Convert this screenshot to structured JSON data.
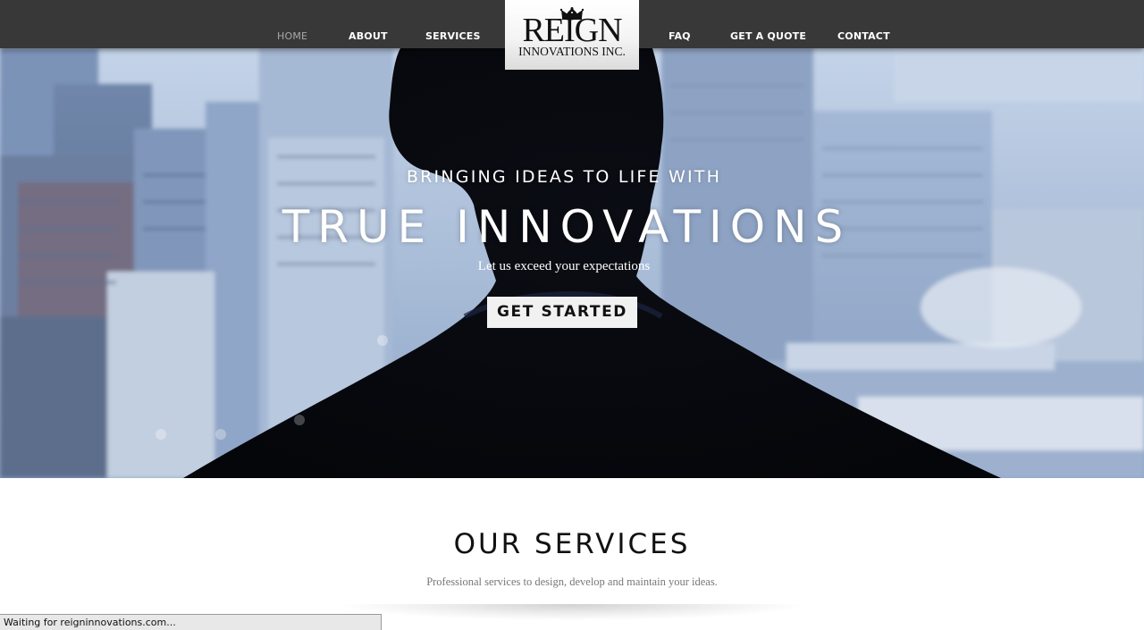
{
  "nav": {
    "items": [
      {
        "label": "HOME",
        "active": true
      },
      {
        "label": "ABOUT"
      },
      {
        "label": "SERVICES"
      },
      {
        "label": "FAQ"
      },
      {
        "label": "GET A QUOTE"
      },
      {
        "label": "CONTACT"
      }
    ]
  },
  "logo": {
    "main": "REIGN",
    "sub": "INNOVATIONS INC.",
    "icon": "crown-icon"
  },
  "hero": {
    "kicker": "BRINGING IDEAS TO LIFE WITH",
    "title": "TRUE INNOVATIONS",
    "subtitle": "Let us exceed your expectations",
    "cta_label": "GET STARTED"
  },
  "services": {
    "title": "OUR SERVICES",
    "description": "Professional services to design, develop and maintain your ideas."
  },
  "browser": {
    "status": "Waiting for reigninnovations.com..."
  },
  "colors": {
    "nav_bg": "#383838",
    "nav_text": "#ffffff",
    "nav_active": "#a9a9a9",
    "cta_bg": "#f1f1f1",
    "hero_tint": "#8ea6c9"
  }
}
